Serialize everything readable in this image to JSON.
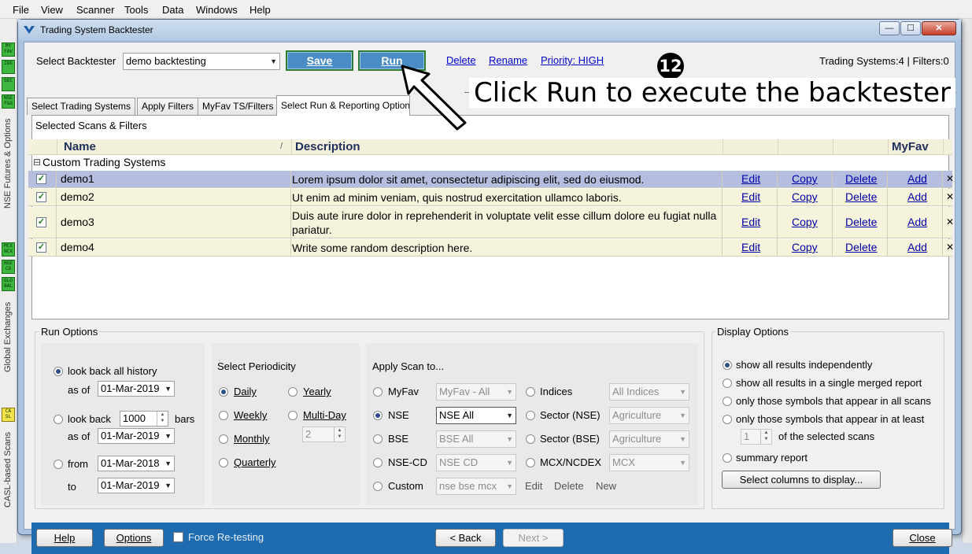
{
  "menu": [
    "File",
    "View",
    "Scanner",
    "Tools",
    "Data",
    "Windows",
    "Help"
  ],
  "sidebar": {
    "group1_boxes": [
      "MY FAV",
      "IDX",
      "SEC",
      "NSE F&O"
    ],
    "group1_label": "NSE Futures & Options",
    "group2_boxes": [
      "MCX NCX",
      "NSE CD",
      "GLO BAL"
    ],
    "group2_label": "Global Exchanges",
    "group3_boxes": [
      "CA SL"
    ],
    "group3_label": "CASL-based Scans"
  },
  "window": {
    "title": "Trading System Backtester"
  },
  "toolbar": {
    "select_label": "Select Backtester",
    "select_value": "demo backtesting",
    "save": "Save",
    "run": "Run",
    "delete": "Delete",
    "rename": "Rename",
    "priority": "Priority: HIGH",
    "counts": "Trading Systems:4 | Filters:0"
  },
  "tabs": [
    "Select Trading Systems",
    "Apply Filters",
    "MyFav TS/Filters",
    "Select Run & Reporting Options"
  ],
  "panel": {
    "subtitle": "Selected Scans & Filters",
    "col_name": "Name",
    "col_desc": "Description",
    "col_myfav": "MyFav",
    "sort_glyph": "/",
    "group_toggle": "⊟",
    "group_title": "Custom Trading Systems"
  },
  "rows": [
    {
      "name": "demo1",
      "desc": "Lorem ipsum dolor sit amet, consectetur adipiscing elit, sed do eiusmod.",
      "edit": "Edit",
      "copy": "Copy",
      "delete": "Delete",
      "add": "Add",
      "x": "✕",
      "check": "✓"
    },
    {
      "name": "demo2",
      "desc": "Ut enim ad minim veniam, quis nostrud exercitation ullamco laboris.",
      "edit": "Edit",
      "copy": "Copy",
      "delete": "Delete",
      "add": "Add",
      "x": "✕",
      "check": "✓"
    },
    {
      "name": "demo3",
      "desc": "Duis aute irure dolor in reprehenderit in voluptate velit esse cillum dolore eu fugiat nulla pariatur.",
      "edit": "Edit",
      "copy": "Copy",
      "delete": "Delete",
      "add": "Add",
      "x": "✕",
      "check": "✓"
    },
    {
      "name": "demo4",
      "desc": "Write some random description here.",
      "edit": "Edit",
      "copy": "Copy",
      "delete": "Delete",
      "add": "Add",
      "x": "✕",
      "check": "✓"
    }
  ],
  "run_options": {
    "title": "Run Options",
    "lookback_all": "look back all history",
    "as_of": "as of",
    "date1": "01-Mar-2019",
    "look_back": "look back",
    "bars_value": "1000",
    "bars": "bars",
    "as_of2": "as of",
    "date2": "01-Mar-2019",
    "from": "from",
    "from_date": "01-Mar-2018",
    "to": "to",
    "to_date": "01-Mar-2019"
  },
  "periodicity": {
    "title": "Select Periodicity",
    "daily": "Daily",
    "weekly": "Weekly",
    "monthly": "Monthly",
    "quarterly": "Quarterly",
    "yearly": "Yearly",
    "multiday": "Multi-Day",
    "multiday_value": "2"
  },
  "apply_scan": {
    "title": "Apply Scan to...",
    "myfav": "MyFav",
    "myfav_value": "MyFav - All",
    "nse": "NSE",
    "nse_value": "NSE All",
    "bse": "BSE",
    "bse_value": "BSE All",
    "nsecd": "NSE-CD",
    "nsecd_value": "NSE CD",
    "custom": "Custom",
    "custom_value": "nse bse mcx",
    "indices": "Indices",
    "indices_value": "All Indices",
    "sector_nse": "Sector (NSE)",
    "sector_nse_value": "Agriculture",
    "sector_bse": "Sector (BSE)",
    "sector_bse_value": "Agriculture",
    "mcx": "MCX/NCDEX",
    "mcx_value": "MCX",
    "edit": "Edit",
    "delete": "Delete",
    "new": "New"
  },
  "display_options": {
    "title": "Display Options",
    "opt1": "show all results independently",
    "opt2": "show all results in a single merged report",
    "opt3": "only those symbols that appear in all scans",
    "opt4": "only those symbols that appear in at least",
    "atleast_value": "1",
    "selected_scans": "of the selected scans",
    "opt5": "summary report",
    "columns_button": "Select columns to display..."
  },
  "footer": {
    "help": "Help",
    "options": "Options",
    "force": "Force Re-testing",
    "back": "< Back",
    "next": "Next >",
    "close": "Close"
  },
  "annotation": {
    "number": "12",
    "text": "Click Run to execute the backtester"
  }
}
